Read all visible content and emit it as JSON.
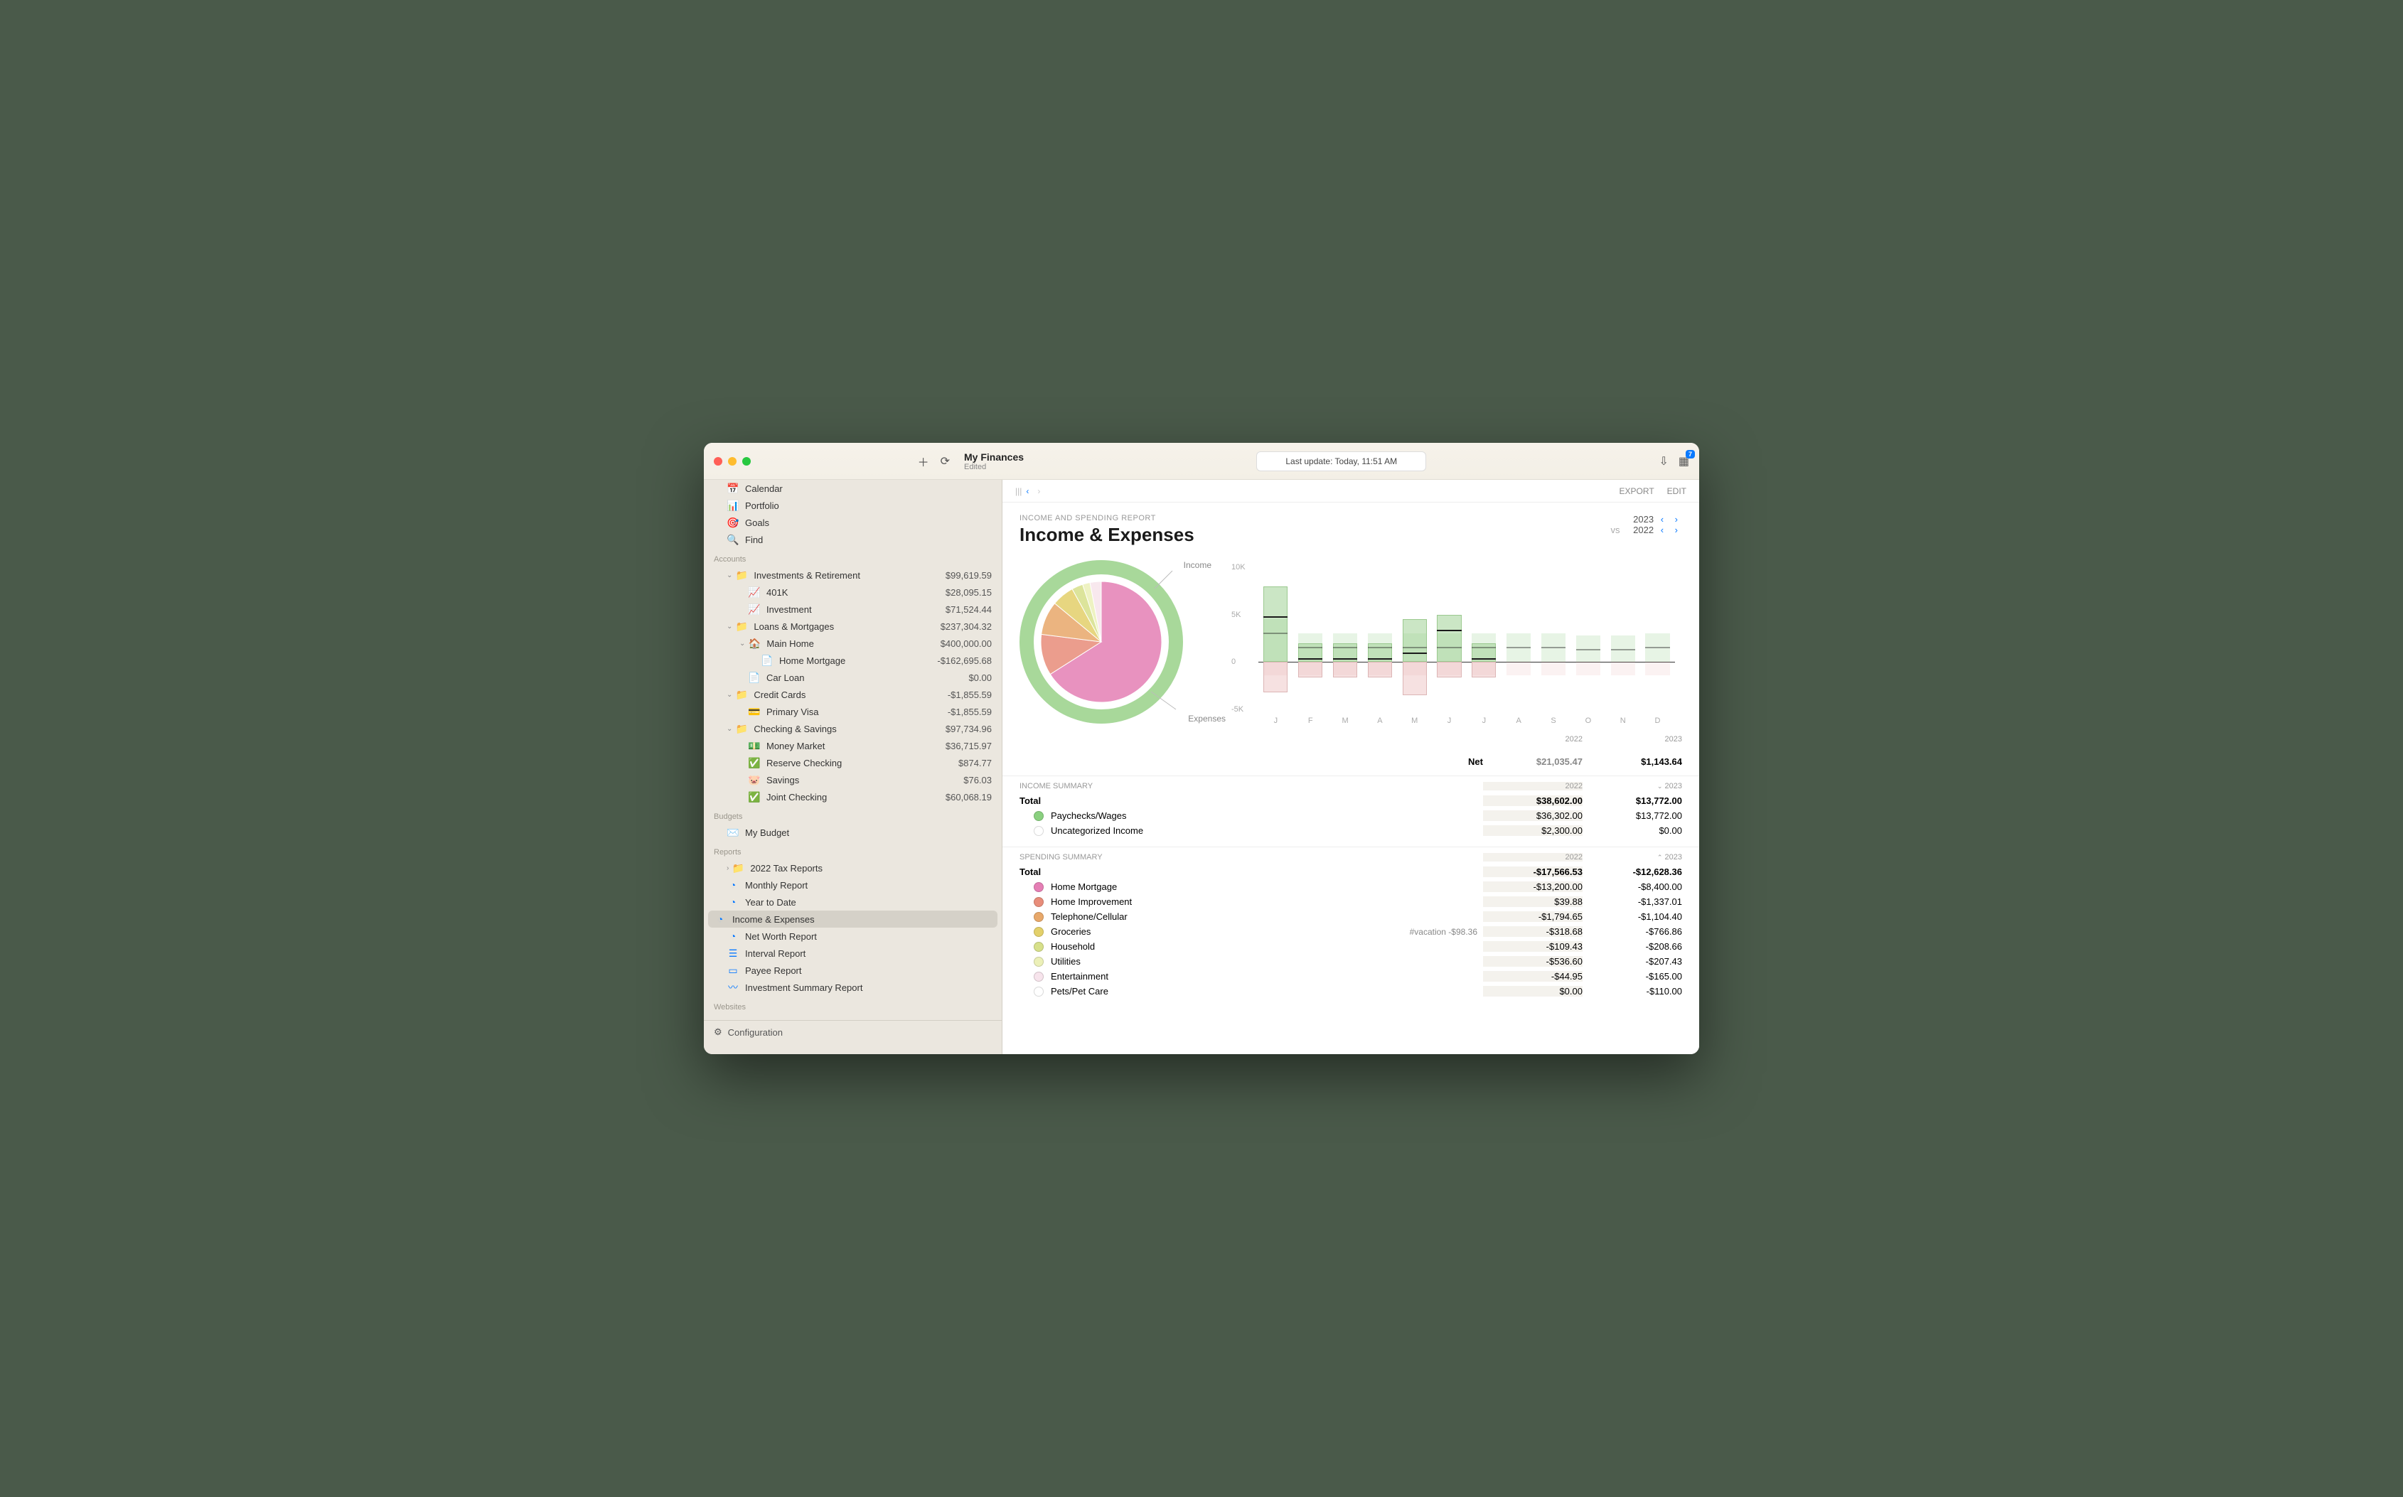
{
  "window": {
    "title": "My Finances",
    "subtitle": "Edited",
    "last_update": "Last update: Today, 11:51 AM",
    "notification_badge": "7"
  },
  "toolbar": {
    "export": "EXPORT",
    "edit": "EDIT"
  },
  "sidebar": {
    "nav": [
      {
        "icon": "calendar-icon",
        "label": "Calendar"
      },
      {
        "icon": "portfolio-icon",
        "label": "Portfolio"
      },
      {
        "icon": "goals-icon",
        "label": "Goals"
      },
      {
        "icon": "search-icon",
        "label": "Find"
      }
    ],
    "sections": {
      "accounts": "Accounts",
      "budgets": "Budgets",
      "reports": "Reports",
      "websites": "Websites"
    },
    "accounts": [
      {
        "label": "Investments & Retirement",
        "value": "$99,619.59",
        "folder": true,
        "expanded": true,
        "children": [
          {
            "label": "401K",
            "value": "$28,095.15",
            "icon": "chart-trend-icon"
          },
          {
            "label": "Investment",
            "value": "$71,524.44",
            "icon": "chart-trend-icon"
          }
        ]
      },
      {
        "label": "Loans & Mortgages",
        "value": "$237,304.32",
        "folder": true,
        "expanded": true,
        "children": [
          {
            "label": "Main Home",
            "value": "$400,000.00",
            "icon": "home-icon",
            "expanded": true,
            "children": [
              {
                "label": "Home Mortgage",
                "value": "-$162,695.68",
                "icon": "document-icon"
              }
            ]
          },
          {
            "label": "Car Loan",
            "value": "$0.00",
            "icon": "document-icon"
          }
        ]
      },
      {
        "label": "Credit Cards",
        "value": "-$1,855.59",
        "folder": true,
        "expanded": true,
        "children": [
          {
            "label": "Primary Visa",
            "value": "-$1,855.59",
            "icon": "card-icon"
          }
        ]
      },
      {
        "label": "Checking & Savings",
        "value": "$97,734.96",
        "folder": true,
        "expanded": true,
        "children": [
          {
            "label": "Money Market",
            "value": "$36,715.97",
            "icon": "money-icon"
          },
          {
            "label": "Reserve Checking",
            "value": "$874.77",
            "icon": "check-icon"
          },
          {
            "label": "Savings",
            "value": "$76.03",
            "icon": "piggy-icon"
          },
          {
            "label": "Joint Checking",
            "value": "$60,068.19",
            "icon": "check-icon"
          }
        ]
      }
    ],
    "budgets": [
      {
        "label": "My Budget",
        "icon": "envelope-icon"
      }
    ],
    "reports": [
      {
        "label": "2022 Tax Reports",
        "icon": "folder-icon",
        "folder": true
      },
      {
        "label": "Monthly Report",
        "icon": "pie-icon"
      },
      {
        "label": "Year to Date",
        "icon": "pie-icon"
      },
      {
        "label": "Income & Expenses",
        "icon": "pie-icon",
        "selected": true
      },
      {
        "label": "Net Worth Report",
        "icon": "pie-icon"
      },
      {
        "label": "Interval Report",
        "icon": "list-icon"
      },
      {
        "label": "Payee Report",
        "icon": "card2-icon"
      },
      {
        "label": "Investment Summary Report",
        "icon": "trend-icon"
      }
    ],
    "config": "Configuration"
  },
  "report": {
    "overline": "INCOME AND SPENDING REPORT",
    "title": "Income & Expenses",
    "year": "2023",
    "vs": "vs",
    "compare_year": "2022",
    "pie_income": "Income",
    "pie_expenses": "Expenses",
    "net_label": "Net",
    "net_2022": "$21,035.47",
    "net_2023": "$1,143.64",
    "y2022": "2022",
    "y2023": "2023"
  },
  "income": {
    "header": "INCOME SUMMARY",
    "total_label": "Total",
    "total_2022": "$38,602.00",
    "total_2023": "$13,772.00",
    "rows": [
      {
        "color": "#8ad07f",
        "name": "Paychecks/Wages",
        "v2022": "$36,302.00",
        "v2023": "$13,772.00"
      },
      {
        "color": "#ffffff",
        "name": "Uncategorized Income",
        "v2022": "$2,300.00",
        "v2023": "$0.00"
      }
    ]
  },
  "spending": {
    "header": "SPENDING SUMMARY",
    "total_label": "Total",
    "total_2022": "-$17,566.53",
    "total_2023": "-$12,628.36",
    "rows": [
      {
        "color": "#e57fb5",
        "name": "Home Mortgage",
        "v2022": "-$13,200.00",
        "v2023": "-$8,400.00"
      },
      {
        "color": "#e88d7a",
        "name": "Home Improvement",
        "v2022": "$39.88",
        "v2023": "-$1,337.01"
      },
      {
        "color": "#e8a86a",
        "name": "Telephone/Cellular",
        "v2022": "-$1,794.65",
        "v2023": "-$1,104.40"
      },
      {
        "color": "#e3d06a",
        "name": "Groceries",
        "tag": "#vacation -$98.36",
        "v2022": "-$318.68",
        "v2023": "-$766.86"
      },
      {
        "color": "#d7e08a",
        "name": "Household",
        "v2022": "-$109.43",
        "v2023": "-$208.66"
      },
      {
        "color": "#ecf0b8",
        "name": "Utilities",
        "v2022": "-$536.60",
        "v2023": "-$207.43"
      },
      {
        "color": "#f7e4ec",
        "name": "Entertainment",
        "v2022": "-$44.95",
        "v2023": "-$165.00"
      },
      {
        "color": "#ffffff",
        "name": "Pets/Pet Care",
        "v2022": "$0.00",
        "v2023": "-$110.00"
      }
    ]
  },
  "chart_data": {
    "type": "bar",
    "ylabel": "",
    "ylim": [
      -5000,
      10000
    ],
    "yticks": [
      -5000,
      0,
      5000,
      10000
    ],
    "ytick_labels": [
      "-5K",
      "0",
      "5K",
      "10K"
    ],
    "categories": [
      "J",
      "F",
      "M",
      "A",
      "M",
      "J",
      "J",
      "A",
      "S",
      "O",
      "N",
      "D"
    ],
    "series": [
      {
        "name": "2023 income",
        "values": [
          8000,
          2000,
          2000,
          2000,
          4500,
          5000,
          2000,
          null,
          null,
          null,
          null,
          null
        ]
      },
      {
        "name": "2023 expense",
        "values": [
          -3200,
          -1600,
          -1600,
          -1600,
          -3500,
          -1600,
          -1600,
          null,
          null,
          null,
          null,
          null
        ]
      },
      {
        "name": "2022 income",
        "values": [
          4500,
          3000,
          3000,
          3000,
          3000,
          3000,
          3000,
          3000,
          3000,
          2800,
          2800,
          3000
        ]
      },
      {
        "name": "2022 expense",
        "values": [
          -1400,
          -1400,
          -1400,
          -1400,
          -1400,
          -1400,
          -1400,
          -1400,
          -1400,
          -1400,
          -1400,
          -1400
        ]
      },
      {
        "name": "2023 net",
        "values": [
          4800,
          400,
          400,
          400,
          1000,
          3400,
          400,
          null,
          null,
          null,
          null,
          null
        ]
      },
      {
        "name": "2022 net",
        "values": [
          3100,
          1600,
          1600,
          1600,
          1600,
          1600,
          1600,
          1600,
          1600,
          1400,
          1400,
          1600
        ]
      }
    ],
    "pie": {
      "type": "pie",
      "title": "",
      "outer_ring": "Income",
      "inner_label": "Expenses",
      "slices": [
        {
          "name": "Home Mortgage",
          "color": "#e57fb5",
          "pct": 66
        },
        {
          "name": "Home Improvement",
          "color": "#e88d7a",
          "pct": 11
        },
        {
          "name": "Telephone/Cellular",
          "color": "#e8a86a",
          "pct": 9
        },
        {
          "name": "Groceries",
          "color": "#e3d06a",
          "pct": 6
        },
        {
          "name": "Household",
          "color": "#d7e08a",
          "pct": 3
        },
        {
          "name": "Utilities",
          "color": "#ecf0b8",
          "pct": 2
        },
        {
          "name": "Other",
          "color": "#f7e4ec",
          "pct": 3
        }
      ]
    }
  }
}
